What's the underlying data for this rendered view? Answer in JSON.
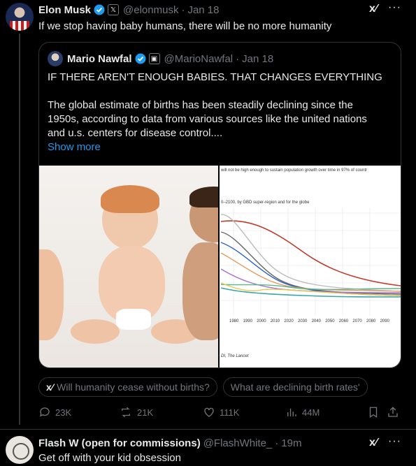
{
  "tweet": {
    "author_name": "Elon Musk",
    "handle": "@elonmusk",
    "time": "Jan 18",
    "text": "If we stop having baby humans, there will be no more humanity"
  },
  "quote": {
    "author_name": "Mario Nawfal",
    "handle": "@MarioNawfal",
    "time": "Jan 18",
    "line1": "IF THERE AREN'T ENOUGH BABIES. THAT CHANGES EVERYTHING",
    "line2": "The global estimate of births has been steadily declining since the",
    "line3": "1950s, according to data from various sources like the united nations",
    "line4": "and u.s. centers for disease control....",
    "show_more": "Show more",
    "chart_caption1": "will not be high enough to sustain population growth over time in 97% of countr",
    "chart_caption2": "0–2100, by GBD super-region and for the globe",
    "chart_source": "DI, The Lancet",
    "chart_years": [
      "1980",
      "1990",
      "2000",
      "2010",
      "2020",
      "2030",
      "2040",
      "2050",
      "2060",
      "2070",
      "2080",
      "2090"
    ]
  },
  "chips": [
    "Will humanity cease without births?",
    "What are declining birth rates'"
  ],
  "actions": {
    "replies": "23K",
    "reposts": "21K",
    "likes": "111K",
    "views": "44M"
  },
  "reply": {
    "author_name": "Flash W (open for commissions)",
    "handle": "@FlashWhite_",
    "time": "19m",
    "text": "Get off with your kid obsession"
  },
  "icons": {
    "grok": "grok-icon",
    "more": "more-icon",
    "verified_color": "#1d9bf0"
  }
}
